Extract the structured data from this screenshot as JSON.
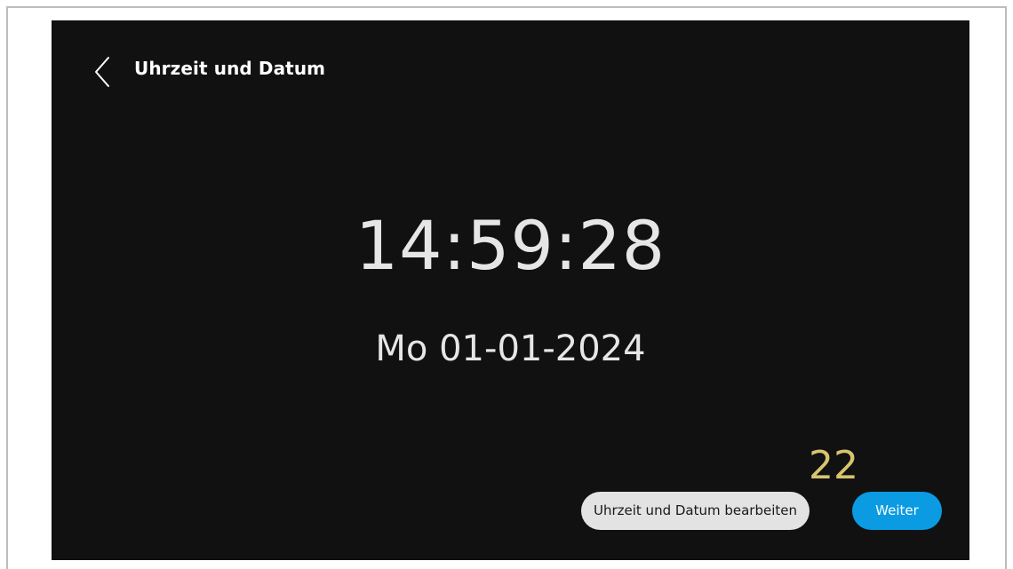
{
  "header": {
    "back_icon": "chevron-left-icon",
    "title": "Uhrzeit und Datum"
  },
  "clock": {
    "time": "14:59:28",
    "date": "Mo 01-01-2024"
  },
  "annotation": {
    "label": "22",
    "color": "#d8c370"
  },
  "actions": {
    "edit_label": "Uhrzeit und Datum bearbeiten",
    "next_label": "Weiter"
  },
  "colors": {
    "background": "#111111",
    "accent": "#0a9be3",
    "secondary_button": "#e3e3e3"
  }
}
